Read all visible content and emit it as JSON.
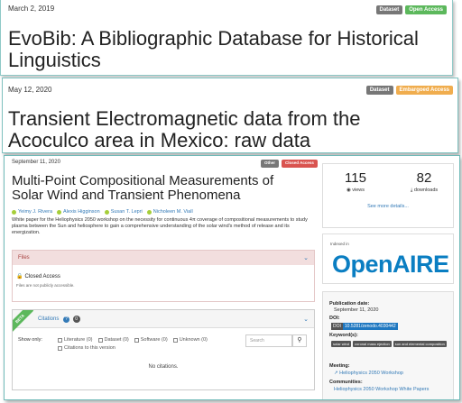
{
  "records": [
    {
      "date": "March 2, 2019",
      "badges": [
        "Dataset",
        "Open Access"
      ],
      "title_line1": "EvoBib: A Bibliographic Database for Historical",
      "title_line2": "Linguistics"
    },
    {
      "date": "May 12, 2020",
      "badges": [
        "Dataset",
        "Embargoed Access"
      ],
      "title_line1": "Transient Electromagnetic data from the",
      "title_line2": "Acoculco area in Mexico: raw data"
    }
  ],
  "detail": {
    "date": "September 11, 2020",
    "badges": [
      "Other",
      "Closed Access"
    ],
    "title": "Multi-Point Compositional Measurements of Solar Wind and Transient Phenomena",
    "authors": [
      "Yeimy J. Rivera",
      "Alexis Higginson",
      "Susan T. Lepri",
      "Nicholeen M. Viall"
    ],
    "description": "White paper for the Heliophysics 2050 workshop on the necessity for continuous 4π coverage of compositional measurements to study plasma between the Sun and heliosphere to gain a comprehensive understanding of the solar wind's method of release and its energization.",
    "files": {
      "heading": "Files",
      "access_label": "Closed Access",
      "access_note": "Files are not publicly accessible."
    },
    "citations": {
      "ribbon": "BETA",
      "heading": "Citations",
      "count": "0",
      "show_only": "Show only:",
      "filters": [
        "Literature (0)",
        "Dataset (0)",
        "Software (0)",
        "Unknown (0)",
        "Citations to this version"
      ],
      "search_placeholder": "Search",
      "empty": "No citations."
    },
    "stats": {
      "views": "115",
      "views_label": "views",
      "downloads": "82",
      "downloads_label": "downloads",
      "see_more": "See more details..."
    },
    "openaire": {
      "indexed": "Indexed in",
      "logo": "OpenAIRE"
    },
    "meta": {
      "pub_label": "Publication date:",
      "pub_value": "September 11, 2020",
      "doi_label": "DOI:",
      "doi_badge": "DOI",
      "doi_value": "10.5281/zenodo.4030442",
      "kw_label": "Keyword(s):",
      "keywords": [
        "solar wind",
        "coronal mass ejection",
        "sun and elemental composition"
      ],
      "meeting_label": "Meeting:",
      "meeting_value": "Heliophysics 2050 Workshop",
      "communities_label": "Communities:",
      "communities_value": "Heliophysics 2050 Workshop White Papers"
    }
  },
  "colors": {
    "dataset_badge": "#777777",
    "open_access": "#5cb85c",
    "embargoed": "#f0ad4e",
    "closed_access": "#d9534f",
    "link": "#337ab7",
    "openaire_blue": "#0a7ec2"
  }
}
